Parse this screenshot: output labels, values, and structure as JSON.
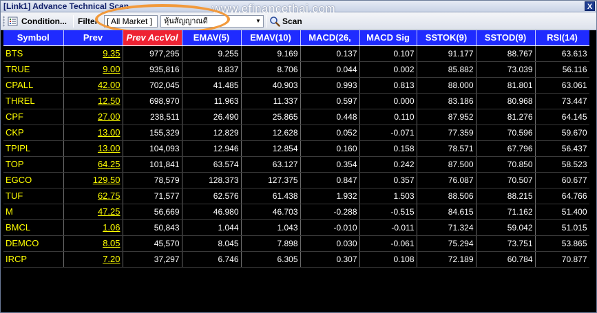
{
  "window": {
    "title": "[Link1] Advance Technical Scan",
    "watermark": "www.efinancethai.com",
    "close_glyph": "X"
  },
  "toolbar": {
    "condition_label": "Condition...",
    "filter_label": "Filter",
    "market_value": "[ All Market ]",
    "sector_value": "หุ้นสัญญาณดี",
    "scan_label": "Scan"
  },
  "icons": {
    "condition": "conditions-list-icon",
    "scan": "magnifier-icon",
    "dropdown": "chevron-down-icon"
  },
  "colors": {
    "header_bg": "#1f2bff",
    "selected_header_bg": "#ee2233",
    "symbol_text": "#ffff00",
    "highlight_ring": "#f29a3c"
  },
  "table": {
    "columns": [
      "Symbol",
      "Prev",
      "Prev AccVol",
      "EMAV(5)",
      "EMAV(10)",
      "MACD(26,",
      "MACD Sig",
      "SSTOK(9)",
      "SSTOD(9)",
      "RSI(14)"
    ],
    "rows": [
      [
        "BTS",
        "9.35",
        "977,295",
        "9.255",
        "9.169",
        "0.137",
        "0.107",
        "91.177",
        "88.767",
        "63.613"
      ],
      [
        "TRUE",
        "9.00",
        "935,816",
        "8.837",
        "8.706",
        "0.044",
        "0.002",
        "85.882",
        "73.039",
        "56.116"
      ],
      [
        "CPALL",
        "42.00",
        "702,045",
        "41.485",
        "40.903",
        "0.993",
        "0.813",
        "88.000",
        "81.801",
        "63.061"
      ],
      [
        "THREL",
        "12.50",
        "698,970",
        "11.963",
        "11.337",
        "0.597",
        "0.000",
        "83.186",
        "80.968",
        "73.447"
      ],
      [
        "CPF",
        "27.00",
        "238,511",
        "26.490",
        "25.865",
        "0.448",
        "0.110",
        "87.952",
        "81.276",
        "64.145"
      ],
      [
        "CKP",
        "13.00",
        "155,329",
        "12.829",
        "12.628",
        "0.052",
        "-0.071",
        "77.359",
        "70.596",
        "59.670"
      ],
      [
        "TPIPL",
        "13.00",
        "104,093",
        "12.946",
        "12.854",
        "0.160",
        "0.158",
        "78.571",
        "67.796",
        "56.437"
      ],
      [
        "TOP",
        "64.25",
        "101,841",
        "63.574",
        "63.127",
        "0.354",
        "0.242",
        "87.500",
        "70.850",
        "58.523"
      ],
      [
        "EGCO",
        "129.50",
        "78,579",
        "128.373",
        "127.375",
        "0.847",
        "0.357",
        "76.087",
        "70.507",
        "60.677"
      ],
      [
        "TUF",
        "62.75",
        "71,577",
        "62.576",
        "61.438",
        "1.932",
        "1.503",
        "88.506",
        "88.215",
        "64.766"
      ],
      [
        "M",
        "47.25",
        "56,669",
        "46.980",
        "46.703",
        "-0.288",
        "-0.515",
        "84.615",
        "71.162",
        "51.400"
      ],
      [
        "BMCL",
        "1.06",
        "50,843",
        "1.044",
        "1.043",
        "-0.010",
        "-0.011",
        "71.324",
        "59.042",
        "51.015"
      ],
      [
        "DEMCO",
        "8.05",
        "45,570",
        "8.045",
        "7.898",
        "0.030",
        "-0.061",
        "75.294",
        "73.751",
        "53.865"
      ],
      [
        "IRCP",
        "7.20",
        "37,297",
        "6.746",
        "6.305",
        "0.307",
        "0.108",
        "72.189",
        "60.784",
        "70.877"
      ]
    ]
  }
}
